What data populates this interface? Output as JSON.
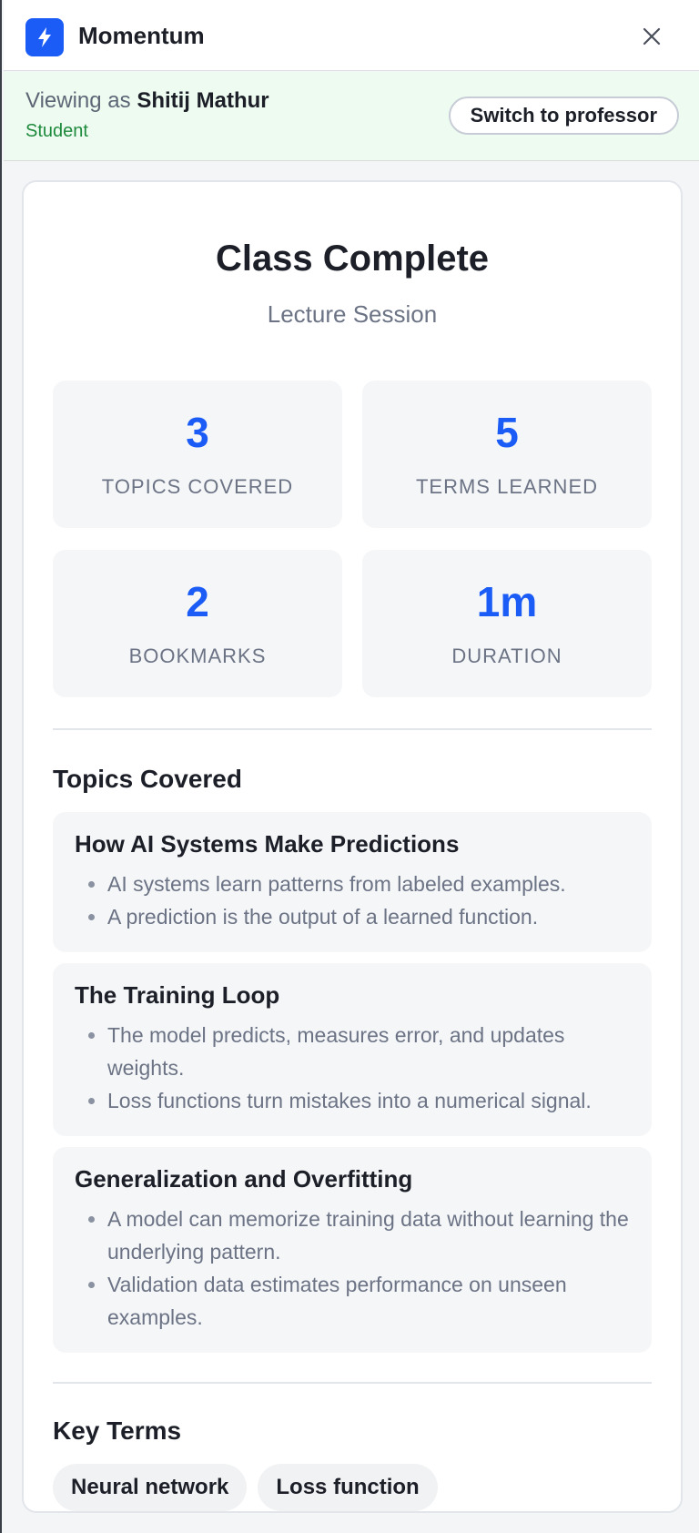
{
  "app": {
    "title": "Momentum",
    "logo_icon": "lightning-bolt-icon",
    "close_icon": "close-icon",
    "accent_color": "#1a5cf5"
  },
  "viewer": {
    "prefix": "Viewing as",
    "name": "Shitij Mathur",
    "role": "Student",
    "switch_label": "Switch to professor"
  },
  "summary": {
    "title": "Class Complete",
    "subtitle": "Lecture Session",
    "stats": [
      {
        "value": "3",
        "label": "TOPICS COVERED"
      },
      {
        "value": "5",
        "label": "TERMS LEARNED"
      },
      {
        "value": "2",
        "label": "BOOKMARKS"
      },
      {
        "value": "1m",
        "label": "DURATION"
      }
    ]
  },
  "topics": {
    "heading": "Topics Covered",
    "items": [
      {
        "title": "How AI Systems Make Predictions",
        "points": [
          "AI systems learn patterns from labeled examples.",
          "A prediction is the output of a learned function."
        ]
      },
      {
        "title": "The Training Loop",
        "points": [
          "The model predicts, measures error, and updates weights.",
          "Loss functions turn mistakes into a numerical signal."
        ]
      },
      {
        "title": "Generalization and Overfitting",
        "points": [
          "A model can memorize training data without learning the underlying pattern.",
          "Validation data estimates performance on unseen examples."
        ]
      }
    ]
  },
  "key_terms": {
    "heading": "Key Terms",
    "items": [
      "Neural network",
      "Loss function"
    ]
  }
}
